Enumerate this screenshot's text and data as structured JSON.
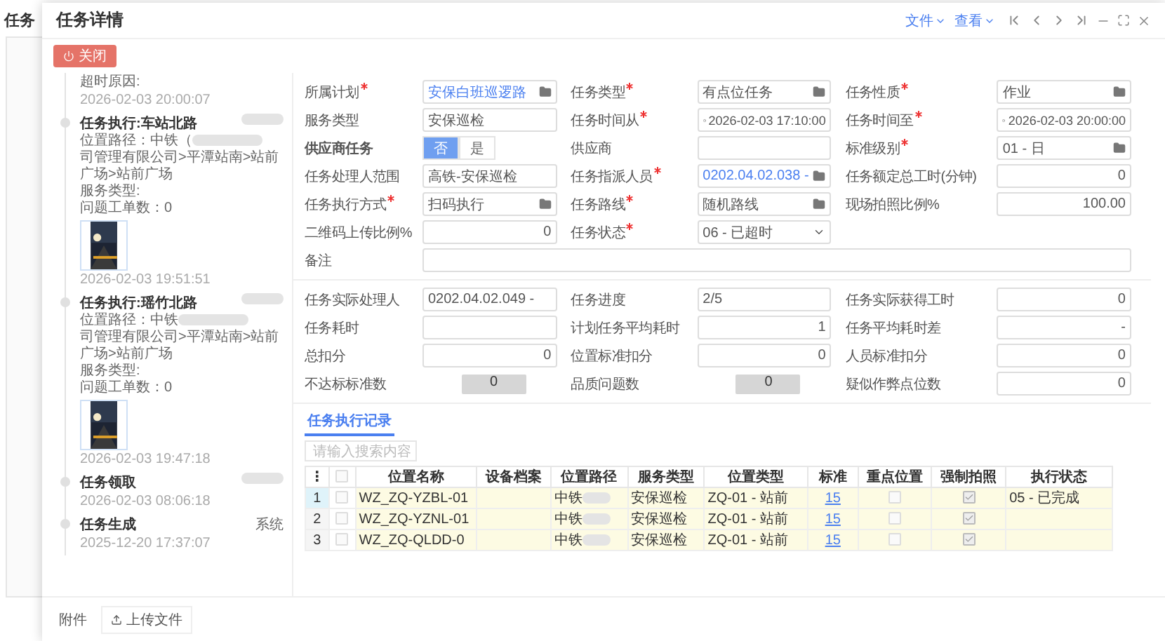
{
  "background": {
    "title": "任务"
  },
  "window": {
    "title": "任务详情",
    "menus": [
      "文件",
      "查看"
    ]
  },
  "close_button": "关闭",
  "timeline": {
    "lead": {
      "text": "超时原因:",
      "time": "2026-02-03 20:00:07"
    },
    "items": [
      {
        "title": "任务执行:车站北路",
        "path_start": "位置路径：中铁（",
        "path_end": "司管理有限公司>平潭站南>站前广场>站前广场",
        "lines": [
          "服务类型:",
          "问题工单数：0"
        ],
        "photo": true,
        "time": "2026-02-03 19:51:51"
      },
      {
        "title": "任务执行:瑶竹北路",
        "path_start": "位置路径：中铁",
        "path_end": "司管理有限公司>平潭站南>站前广场>站前广场",
        "lines": [
          "服务类型:",
          "问题工单数：0"
        ],
        "photo": true,
        "time": "2026-02-03 19:47:18"
      },
      {
        "title": "任务领取",
        "time": "2026-02-03 08:06:18"
      },
      {
        "title": "任务生成",
        "actor": "系统",
        "time": "2025-12-20 17:37:07"
      }
    ]
  },
  "form": [
    {
      "label": "所属计划",
      "required": true,
      "kind": "picker",
      "value": "安保白班巡逻路",
      "link": true
    },
    {
      "label": "任务类型",
      "required": true,
      "kind": "picker",
      "value": "有点位任务"
    },
    {
      "label": "任务性质",
      "required": true,
      "kind": "picker",
      "value": "作业"
    },
    {
      "label": "服务类型",
      "kind": "text",
      "value": "安保巡检"
    },
    {
      "label": "任务时间从",
      "required": true,
      "kind": "date",
      "value": "2026-02-03 17:10:00"
    },
    {
      "label": "任务时间至",
      "required": true,
      "kind": "date",
      "value": "2026-02-03 20:00:00"
    },
    {
      "label": "供应商任务",
      "kind": "toggle",
      "options": [
        {
          "label": "否",
          "selected": true
        },
        {
          "label": "是",
          "selected": false
        }
      ]
    },
    {
      "label": "供应商",
      "kind": "text"
    },
    {
      "label": "标准级别",
      "required": true,
      "kind": "picker",
      "value": "01 - 日"
    },
    {
      "label": "任务处理人范围",
      "kind": "text",
      "value": "高铁-安保巡检"
    },
    {
      "label": "任务指派人员",
      "required": true,
      "kind": "picker",
      "value": "0202.04.02.038 -",
      "link": true
    },
    {
      "label": "任务额定总工时(分钟)",
      "kind": "number",
      "value": "0"
    },
    {
      "label": "任务执行方式",
      "required": true,
      "kind": "picker",
      "value": "扫码执行"
    },
    {
      "label": "任务路线",
      "required": true,
      "kind": "picker",
      "value": "随机路线"
    },
    {
      "label": "现场拍照比例%",
      "kind": "number",
      "value": "100.00"
    },
    {
      "label": "二维码上传比例%",
      "kind": "number",
      "value": "0"
    },
    {
      "label": "任务状态",
      "required": true,
      "kind": "select",
      "value": "06 - 已超时"
    },
    {
      "label": "备注",
      "kind": "wide"
    }
  ],
  "results": [
    {
      "label": "任务实际处理人",
      "kind": "text",
      "value": "0202.04.02.049 -"
    },
    {
      "label": "任务进度",
      "kind": "text",
      "value": "2/5"
    },
    {
      "label": "任务实际获得工时",
      "kind": "number",
      "value": "0"
    },
    {
      "label": "任务耗时",
      "kind": "number"
    },
    {
      "label": "计划任务平均耗时",
      "kind": "number",
      "value": "1"
    },
    {
      "label": "任务平均耗时差",
      "kind": "number",
      "value": "-"
    },
    {
      "label": "总扣分",
      "kind": "number",
      "value": "0"
    },
    {
      "label": "位置标准扣分",
      "kind": "number",
      "value": "0"
    },
    {
      "label": "人员标准扣分",
      "kind": "number",
      "value": "0"
    },
    {
      "label": "不达标标准数",
      "kind": "counter",
      "value": "0"
    },
    {
      "label": "品质问题数",
      "kind": "counter",
      "value": "0"
    },
    {
      "label": "疑似作弊点位数",
      "kind": "number",
      "value": "0"
    }
  ],
  "tabs": [
    {
      "label": "任务执行记录",
      "selected": true
    }
  ],
  "search": {
    "placeholder": "请输入搜索内容"
  },
  "table": {
    "all_checked": false,
    "columns": [
      "⋮",
      "位置名称",
      "设备档案",
      "位置路径",
      "服务类型",
      "位置类型",
      "标准",
      "重点位置",
      "强制拍照",
      "执行状态"
    ],
    "rows": [
      {
        "index": "1",
        "selected": true,
        "checked": false,
        "name": "WZ_ZQ-YZBL-01",
        "path": "中铁",
        "service": "安保巡检",
        "type": "ZQ-01 - 站前",
        "standard": "15",
        "key": false,
        "photo": true,
        "status": "05 - 已完成"
      },
      {
        "index": "2",
        "selected": false,
        "checked": false,
        "name": "WZ_ZQ-YZNL-01",
        "path": "中铁",
        "service": "安保巡检",
        "type": "ZQ-01 - 站前",
        "standard": "15",
        "key": false,
        "photo": true
      },
      {
        "index": "3",
        "selected": false,
        "checked": false,
        "name": "WZ_ZQ-QLDD-0",
        "path": "中铁",
        "service": "安保巡检",
        "type": "ZQ-01 - 站前",
        "standard": "15",
        "key": false,
        "photo": true
      }
    ]
  },
  "footer": {
    "label": "附件",
    "upload": "上传文件"
  }
}
